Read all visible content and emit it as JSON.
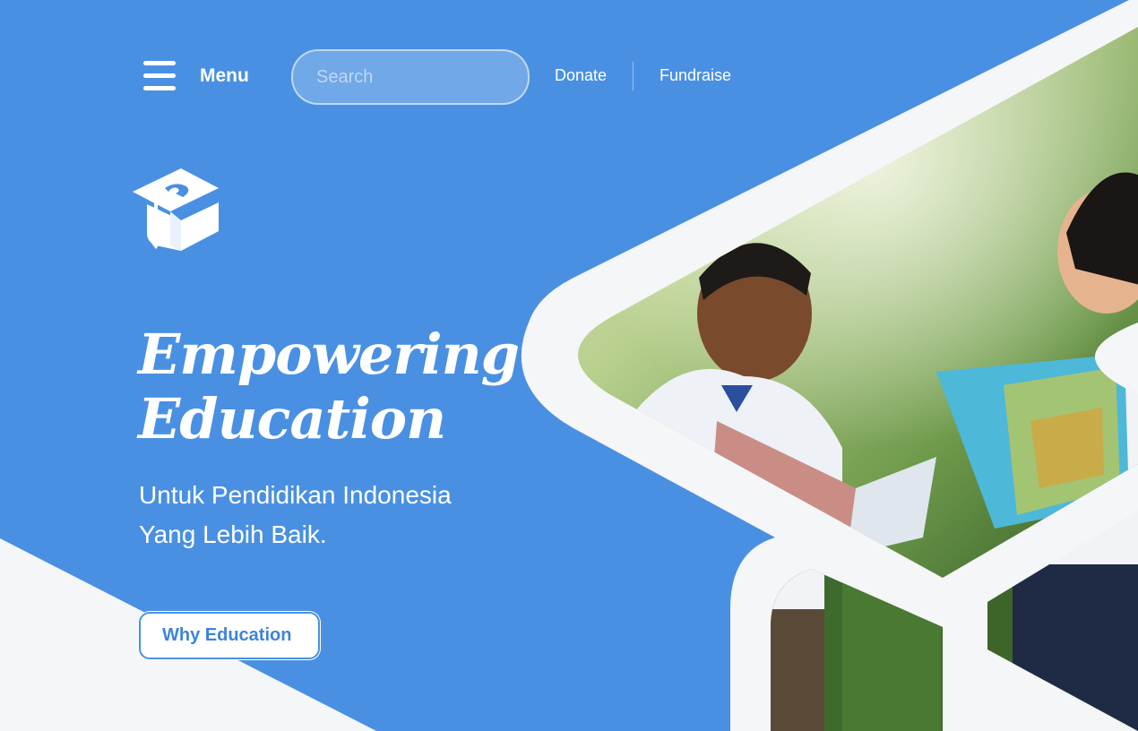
{
  "nav": {
    "menu_label": "Menu",
    "search_placeholder": "Search",
    "links": [
      "Donate",
      "Fundraise"
    ]
  },
  "hero": {
    "title_line1": "Empowering",
    "title_line2": "Education",
    "subtitle_line1": "Untuk Pendidikan Indonesia",
    "subtitle_line2": "Yang Lebih Baik.",
    "cta_label": "Why Education"
  },
  "colors": {
    "brand_blue": "#4a90e2",
    "panel_white": "#f5f6f7",
    "text_white": "#ffffff"
  },
  "icons": [
    "hamburger-icon",
    "graduation-cap-icon"
  ]
}
